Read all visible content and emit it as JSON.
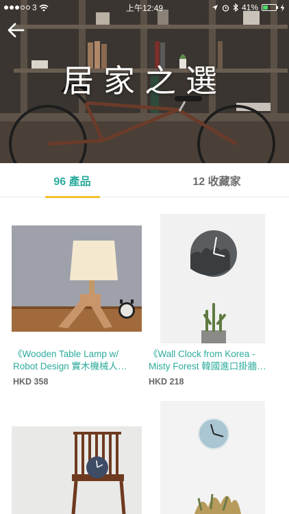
{
  "status": {
    "carrier": "3",
    "time": "上午12:49",
    "battery_percent": 41,
    "battery_label": "41%"
  },
  "hero": {
    "title": "居家之選"
  },
  "tabs": [
    {
      "label": "96 產品",
      "active": true
    },
    {
      "label": "12 收藏家",
      "active": false
    }
  ],
  "products": [
    {
      "title_line1": "《Wooden Table Lamp w/",
      "title_line2": "Robot Design 實木機械人…",
      "price": "HKD 358"
    },
    {
      "title_line1": "《Wall Clock from Korea -",
      "title_line2": "Misty Forest 韓國進口掛牆…",
      "price": "HKD 218"
    },
    {
      "title_line1": "",
      "title_line2": "",
      "price": ""
    },
    {
      "title_line1": "",
      "title_line2": "",
      "price": ""
    }
  ],
  "colors": {
    "accent": "#2bab9c",
    "tab_indicator": "#f2c12e",
    "price": "#666666"
  }
}
